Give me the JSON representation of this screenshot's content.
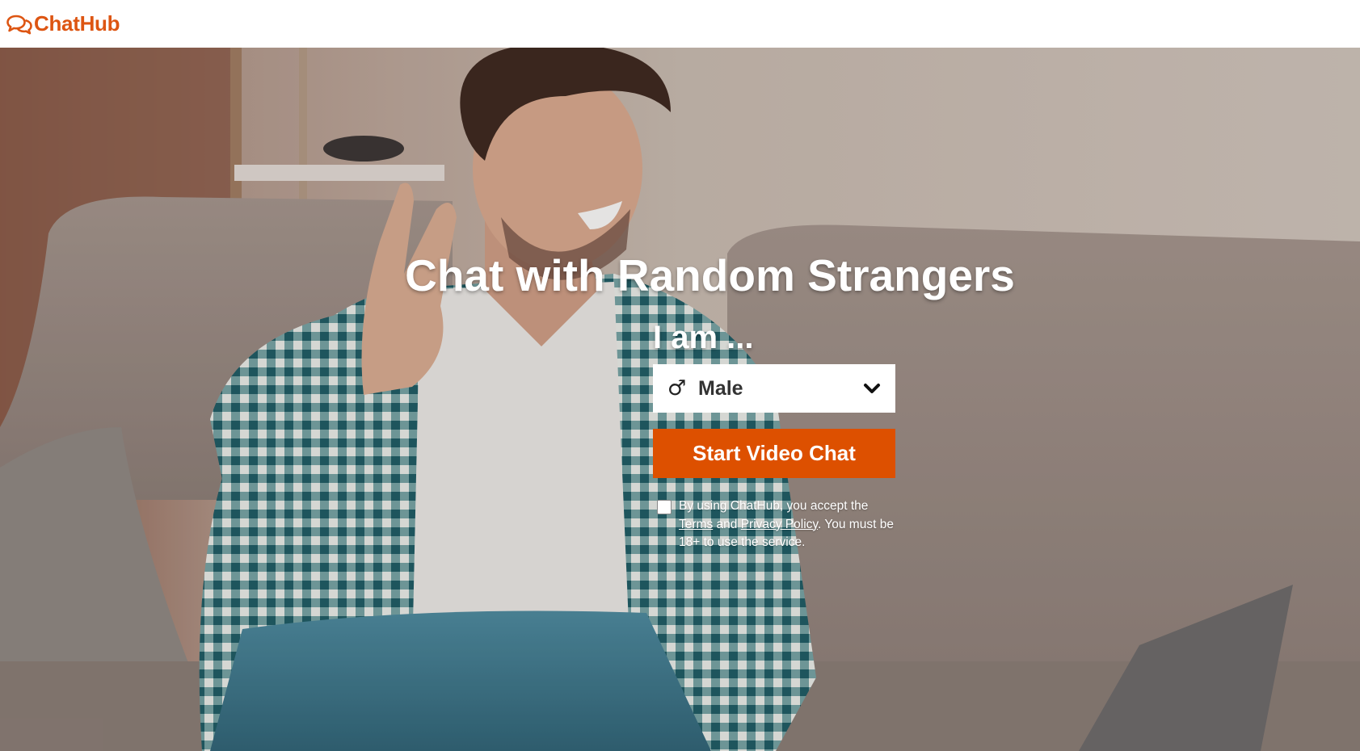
{
  "header": {
    "brand": "ChatHub",
    "logo_icon": "chat-bubbles-icon"
  },
  "colors": {
    "brand": "#dd5512",
    "button": "#dd5000",
    "header_bg": "#ffffff",
    "text_light": "#ffffff"
  },
  "hero": {
    "headline": "Chat with Random Strangers",
    "prompt": "I am ...",
    "gender_select": {
      "selected": "Male",
      "icon": "male-symbol-icon",
      "glyph": "♂",
      "caret_icon": "chevron-down-icon"
    },
    "start_button_label": "Start Video Chat",
    "terms": {
      "checked": false,
      "prefix": "By using ChatHub, you accept the ",
      "terms_link": "Terms",
      "and": " and ",
      "privacy_link": "Privacy Policy",
      "suffix": ". You must be 18+ to use the service."
    }
  }
}
